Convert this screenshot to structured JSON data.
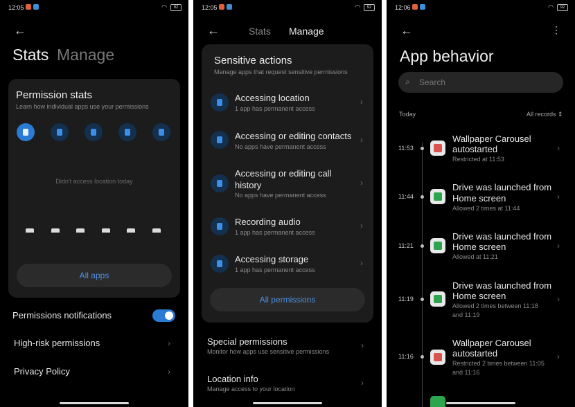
{
  "status": {
    "screen1_time": "12:05",
    "screen2_time": "12:05",
    "screen3_time": "12:06",
    "battery": "92"
  },
  "screen1": {
    "header": {
      "title": "Stats",
      "inactive_tab": "Manage"
    },
    "card": {
      "title": "Permission stats",
      "subtitle": "Learn how individual apps use your permissions",
      "empty_text": "Didn't access location today",
      "all_apps": "All apps",
      "icons": [
        "location-icon",
        "contacts-icon",
        "call-history-icon",
        "microphone-icon",
        "storage-icon"
      ]
    },
    "settings": {
      "notifications": "Permissions notifications",
      "notifications_on": true,
      "high_risk": "High-risk permissions",
      "privacy": "Privacy Policy"
    }
  },
  "screen2": {
    "tabs": {
      "stats": "Stats",
      "manage": "Manage"
    },
    "card": {
      "title": "Sensitive actions",
      "subtitle": "Manage apps that request sensitive permissions",
      "items": [
        {
          "title": "Accessing location",
          "sub": "1 app has permanent access",
          "icon": "location-icon"
        },
        {
          "title": "Accessing or editing contacts",
          "sub": "No apps have permanent access",
          "icon": "contacts-icon"
        },
        {
          "title": "Accessing or editing call",
          "title2": "history",
          "sub": "No apps have permanent access",
          "icon": "call-history-icon"
        },
        {
          "title": "Recording audio",
          "sub": "1 app has permanent access",
          "icon": "microphone-icon"
        },
        {
          "title": "Accessing storage",
          "sub": "1 app has permanent access",
          "icon": "storage-icon"
        }
      ],
      "all_permissions": "All permissions"
    },
    "special": {
      "title": "Special permissions",
      "sub": "Monitor how apps use sensitive permissions"
    },
    "location": {
      "title": "Location info",
      "sub": "Manage access to your location"
    }
  },
  "screen3": {
    "title": "App behavior",
    "search_placeholder": "Search",
    "section": "Today",
    "filter": "All records",
    "events": [
      {
        "time": "11:53",
        "line1": "Wallpaper Carousel",
        "line2": "autostarted",
        "detail": "Restricted at 11:53",
        "detail2": "",
        "icon": "wallpaper-carousel-icon"
      },
      {
        "time": "11:44",
        "line1": "Drive was launched from",
        "line2": "Home screen",
        "detail": "Allowed 2 times at 11:44",
        "detail2": "",
        "icon": "google-drive-icon"
      },
      {
        "time": "11:21",
        "line1": "Drive was launched from",
        "line2": "Home screen",
        "detail": "Allowed at 11:21",
        "detail2": "",
        "icon": "google-drive-icon"
      },
      {
        "time": "11:19",
        "line1": "Drive was launched from",
        "line2": "Home screen",
        "detail": "Allowed 2 times between 11:18",
        "detail2": "and 11:19",
        "icon": "google-drive-icon"
      },
      {
        "time": "11:16",
        "line1": "Wallpaper Carousel",
        "line2": "autostarted",
        "detail": "Restricted 2 times between 11:05",
        "detail2": "and 11:16",
        "icon": "wallpaper-carousel-icon"
      }
    ]
  },
  "colors": {
    "accent": "#2a7bd4",
    "link": "#4d8fe0",
    "background": "#000000",
    "card": "#1c1c1c"
  }
}
